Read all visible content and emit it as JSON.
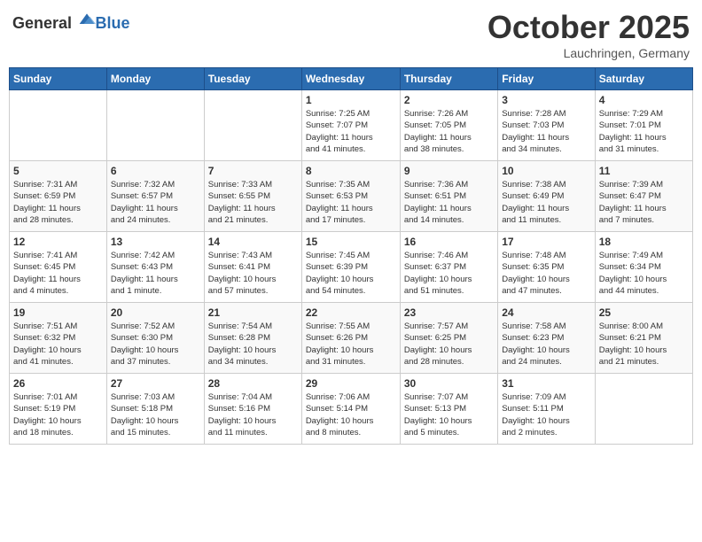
{
  "header": {
    "logo_general": "General",
    "logo_blue": "Blue",
    "month": "October 2025",
    "location": "Lauchringen, Germany"
  },
  "weekdays": [
    "Sunday",
    "Monday",
    "Tuesday",
    "Wednesday",
    "Thursday",
    "Friday",
    "Saturday"
  ],
  "weeks": [
    [
      {
        "day": "",
        "info": ""
      },
      {
        "day": "",
        "info": ""
      },
      {
        "day": "",
        "info": ""
      },
      {
        "day": "1",
        "info": "Sunrise: 7:25 AM\nSunset: 7:07 PM\nDaylight: 11 hours\nand 41 minutes."
      },
      {
        "day": "2",
        "info": "Sunrise: 7:26 AM\nSunset: 7:05 PM\nDaylight: 11 hours\nand 38 minutes."
      },
      {
        "day": "3",
        "info": "Sunrise: 7:28 AM\nSunset: 7:03 PM\nDaylight: 11 hours\nand 34 minutes."
      },
      {
        "day": "4",
        "info": "Sunrise: 7:29 AM\nSunset: 7:01 PM\nDaylight: 11 hours\nand 31 minutes."
      }
    ],
    [
      {
        "day": "5",
        "info": "Sunrise: 7:31 AM\nSunset: 6:59 PM\nDaylight: 11 hours\nand 28 minutes."
      },
      {
        "day": "6",
        "info": "Sunrise: 7:32 AM\nSunset: 6:57 PM\nDaylight: 11 hours\nand 24 minutes."
      },
      {
        "day": "7",
        "info": "Sunrise: 7:33 AM\nSunset: 6:55 PM\nDaylight: 11 hours\nand 21 minutes."
      },
      {
        "day": "8",
        "info": "Sunrise: 7:35 AM\nSunset: 6:53 PM\nDaylight: 11 hours\nand 17 minutes."
      },
      {
        "day": "9",
        "info": "Sunrise: 7:36 AM\nSunset: 6:51 PM\nDaylight: 11 hours\nand 14 minutes."
      },
      {
        "day": "10",
        "info": "Sunrise: 7:38 AM\nSunset: 6:49 PM\nDaylight: 11 hours\nand 11 minutes."
      },
      {
        "day": "11",
        "info": "Sunrise: 7:39 AM\nSunset: 6:47 PM\nDaylight: 11 hours\nand 7 minutes."
      }
    ],
    [
      {
        "day": "12",
        "info": "Sunrise: 7:41 AM\nSunset: 6:45 PM\nDaylight: 11 hours\nand 4 minutes."
      },
      {
        "day": "13",
        "info": "Sunrise: 7:42 AM\nSunset: 6:43 PM\nDaylight: 11 hours\nand 1 minute."
      },
      {
        "day": "14",
        "info": "Sunrise: 7:43 AM\nSunset: 6:41 PM\nDaylight: 10 hours\nand 57 minutes."
      },
      {
        "day": "15",
        "info": "Sunrise: 7:45 AM\nSunset: 6:39 PM\nDaylight: 10 hours\nand 54 minutes."
      },
      {
        "day": "16",
        "info": "Sunrise: 7:46 AM\nSunset: 6:37 PM\nDaylight: 10 hours\nand 51 minutes."
      },
      {
        "day": "17",
        "info": "Sunrise: 7:48 AM\nSunset: 6:35 PM\nDaylight: 10 hours\nand 47 minutes."
      },
      {
        "day": "18",
        "info": "Sunrise: 7:49 AM\nSunset: 6:34 PM\nDaylight: 10 hours\nand 44 minutes."
      }
    ],
    [
      {
        "day": "19",
        "info": "Sunrise: 7:51 AM\nSunset: 6:32 PM\nDaylight: 10 hours\nand 41 minutes."
      },
      {
        "day": "20",
        "info": "Sunrise: 7:52 AM\nSunset: 6:30 PM\nDaylight: 10 hours\nand 37 minutes."
      },
      {
        "day": "21",
        "info": "Sunrise: 7:54 AM\nSunset: 6:28 PM\nDaylight: 10 hours\nand 34 minutes."
      },
      {
        "day": "22",
        "info": "Sunrise: 7:55 AM\nSunset: 6:26 PM\nDaylight: 10 hours\nand 31 minutes."
      },
      {
        "day": "23",
        "info": "Sunrise: 7:57 AM\nSunset: 6:25 PM\nDaylight: 10 hours\nand 28 minutes."
      },
      {
        "day": "24",
        "info": "Sunrise: 7:58 AM\nSunset: 6:23 PM\nDaylight: 10 hours\nand 24 minutes."
      },
      {
        "day": "25",
        "info": "Sunrise: 8:00 AM\nSunset: 6:21 PM\nDaylight: 10 hours\nand 21 minutes."
      }
    ],
    [
      {
        "day": "26",
        "info": "Sunrise: 7:01 AM\nSunset: 5:19 PM\nDaylight: 10 hours\nand 18 minutes."
      },
      {
        "day": "27",
        "info": "Sunrise: 7:03 AM\nSunset: 5:18 PM\nDaylight: 10 hours\nand 15 minutes."
      },
      {
        "day": "28",
        "info": "Sunrise: 7:04 AM\nSunset: 5:16 PM\nDaylight: 10 hours\nand 11 minutes."
      },
      {
        "day": "29",
        "info": "Sunrise: 7:06 AM\nSunset: 5:14 PM\nDaylight: 10 hours\nand 8 minutes."
      },
      {
        "day": "30",
        "info": "Sunrise: 7:07 AM\nSunset: 5:13 PM\nDaylight: 10 hours\nand 5 minutes."
      },
      {
        "day": "31",
        "info": "Sunrise: 7:09 AM\nSunset: 5:11 PM\nDaylight: 10 hours\nand 2 minutes."
      },
      {
        "day": "",
        "info": ""
      }
    ]
  ]
}
